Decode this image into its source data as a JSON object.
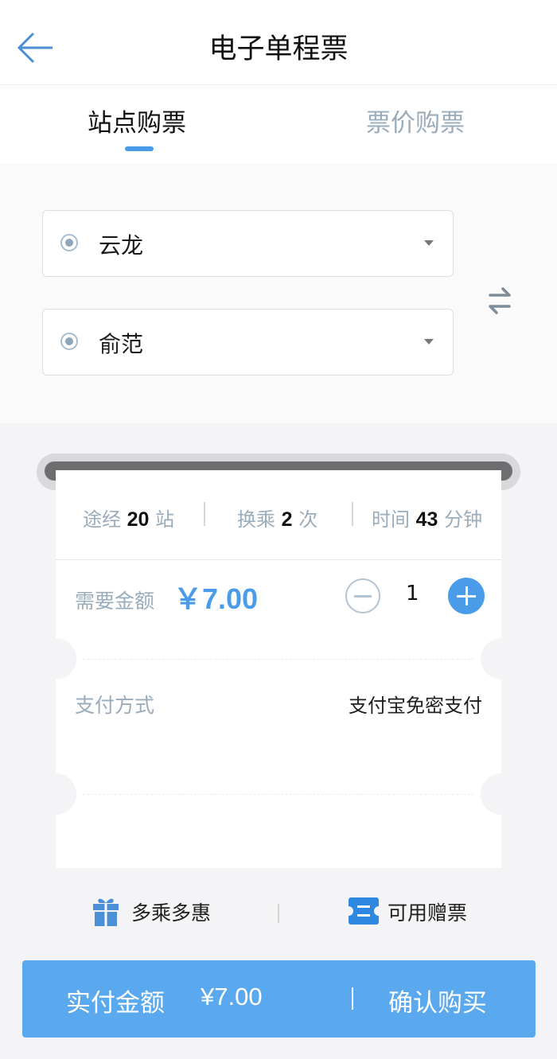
{
  "header": {
    "title": "电子单程票",
    "back_icon": "arrow-left-icon"
  },
  "tabs": [
    {
      "label": "站点购票",
      "active": true
    },
    {
      "label": "票价购票",
      "active": false
    }
  ],
  "stations": {
    "from": {
      "name": "云龙"
    },
    "to": {
      "name": "俞范"
    },
    "swap_icon": "swap-arrows-icon"
  },
  "route_stats": {
    "stops": {
      "prefix": "途经",
      "value": "20",
      "suffix": "站"
    },
    "transfers": {
      "prefix": "换乘",
      "value": "2",
      "suffix": "次"
    },
    "time": {
      "prefix": "时间",
      "value": "43",
      "suffix": "分钟"
    }
  },
  "amount": {
    "label": "需要金额",
    "value": "￥7.00",
    "quantity": "1"
  },
  "payment": {
    "label": "支付方式",
    "method": "支付宝免密支付"
  },
  "promos": [
    {
      "label": "多乘多惠",
      "icon": "gift-icon"
    },
    {
      "label": "可用赠票",
      "icon": "ticket-icon"
    }
  ],
  "checkout": {
    "label": "实付金额",
    "amount": "¥7.00",
    "confirm": "确认购买"
  },
  "colors": {
    "accent": "#4b9ce8",
    "button": "#5aa8ee",
    "muted": "#9aacbb"
  }
}
